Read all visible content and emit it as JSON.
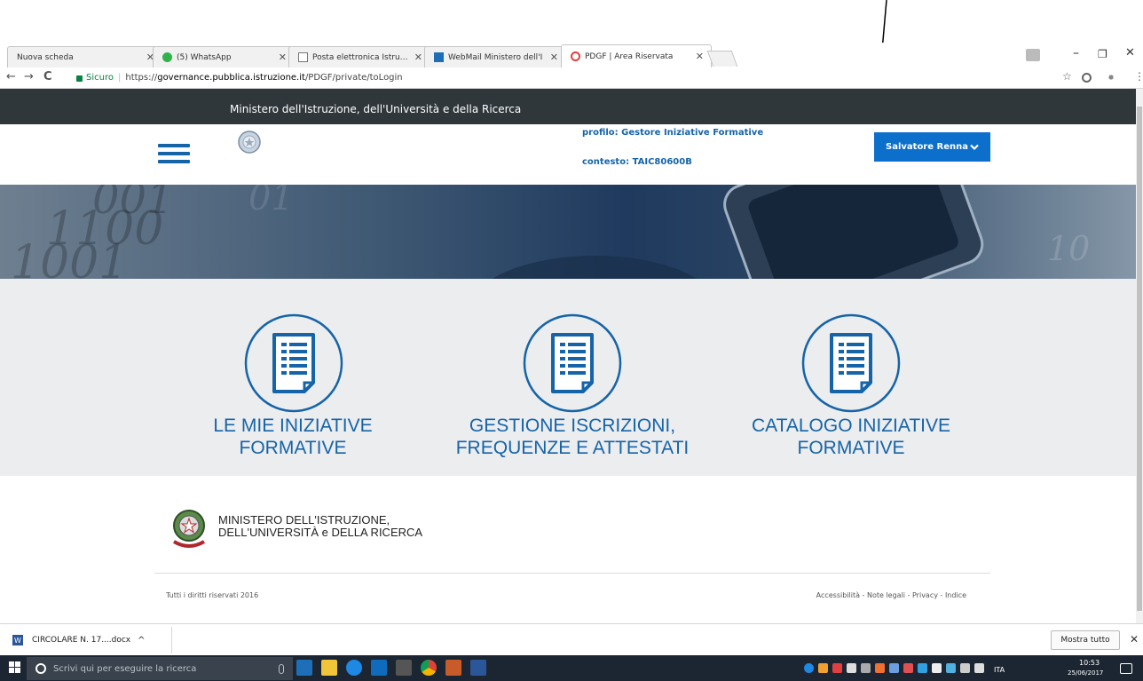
{
  "browser": {
    "tabs": [
      {
        "label": "Nuova scheda",
        "active": false
      },
      {
        "label": "(5) WhatsApp",
        "active": false
      },
      {
        "label": "Posta elettronica Istruzio",
        "active": false
      },
      {
        "label": "WebMail Ministero dell'I",
        "active": false
      },
      {
        "label": "PDGF | Area Riservata",
        "active": true
      }
    ],
    "address": {
      "secure_label": "Sicuro",
      "url_prefix": "https://",
      "url_host": "governance.pubblica.istruzione.it",
      "url_path": "/PDGF/private/toLogin"
    },
    "window_buttons": {
      "minimize": "–",
      "restore": "❐",
      "close": "✕"
    },
    "nav_icons": {
      "back": "←",
      "forward": "→",
      "reload": "C"
    },
    "toolbar_icons": {
      "star": "☆",
      "menu": "⋮"
    }
  },
  "page": {
    "ministry_title": "Ministero dell'Istruzione, dell'Università e della Ricerca",
    "header": {
      "profilo": "profilo: Gestore Iniziative Formative",
      "contesto": "contesto: TAIC80600B",
      "user_button": "Salvatore Renna"
    },
    "tiles": [
      {
        "line1": "LE MIE INIZIATIVE",
        "line2": "FORMATIVE"
      },
      {
        "line1": "GESTIONE ISCRIZIONI,",
        "line2": "FREQUENZE E ATTESTATI"
      },
      {
        "line1": "CATALOGO INIZIATIVE",
        "line2": "FORMATIVE"
      }
    ],
    "footer": {
      "ministry_line1": "MINISTERO DELL'ISTRUZIONE,",
      "ministry_line2": "DELL'UNIVERSITÀ e DELLA RICERCA",
      "copyright": "Tutti i diritti riservati 2016",
      "links": "Accessibilità - Note legali - Privacy - Indice"
    },
    "hero_digits": [
      "001",
      "1100",
      "1001",
      "01",
      "10"
    ],
    "colors": {
      "accent": "#1564a8",
      "button": "#0b6fcb",
      "ministry_bar": "#30373b",
      "section_bg": "#ecedef"
    }
  },
  "download_bar": {
    "file": "CIRCOLARE N. 17....docx",
    "chevron": "^",
    "show_all": "Mostra tutto",
    "close": "✕"
  },
  "taskbar": {
    "search_placeholder": "Scrivi qui per eseguire la ricerca",
    "language": "ITA",
    "time": "10:53",
    "date": "25/06/2017"
  }
}
